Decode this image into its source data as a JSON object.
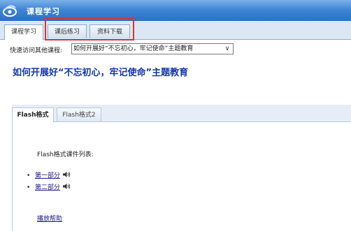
{
  "header": {
    "title": "课程学习"
  },
  "tabs": [
    {
      "label": "课程学习",
      "active": true
    },
    {
      "label": "课后练习",
      "active": false
    },
    {
      "label": "资料下载",
      "active": false
    }
  ],
  "quick_access": {
    "label": "快速访问其他课程:",
    "selected": "如何开展好“不忘初心，牢记使命”主题教育"
  },
  "course": {
    "title": "如何开展好“不忘初心，牢记使命”主题教育"
  },
  "format_tabs": [
    {
      "label": "Flash格式",
      "active": true
    },
    {
      "label": "Flash格式2",
      "active": false
    }
  ],
  "content": {
    "list_label": "Flash格式课件列表:",
    "items": [
      {
        "label": "第一部分"
      },
      {
        "label": "第二部分"
      }
    ],
    "help_link": "播放帮助"
  },
  "colors": {
    "title_bar": "#3f86d6",
    "course_title": "#1238a8",
    "highlight": "#e03030"
  }
}
